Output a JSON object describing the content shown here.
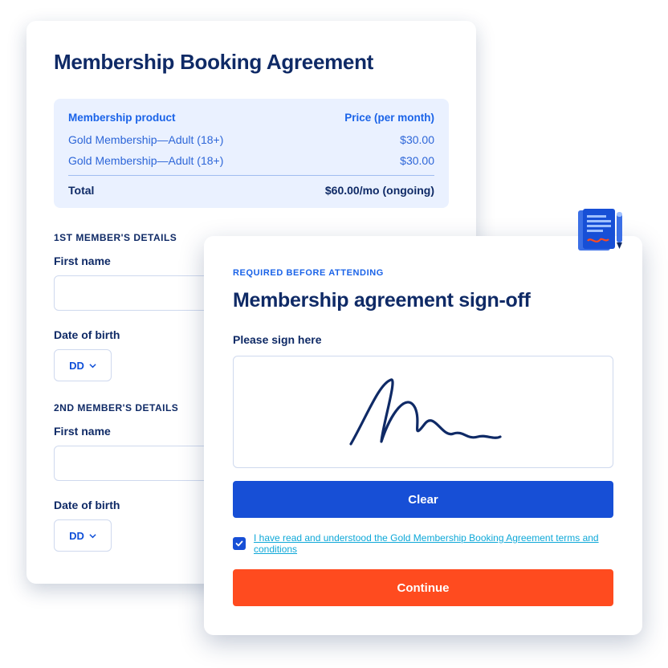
{
  "back": {
    "title": "Membership Booking Agreement",
    "table": {
      "head_product": "Membership product",
      "head_price": "Price (per month)",
      "rows": [
        {
          "product": "Gold Membership—Adult (18+)",
          "price": "$30.00"
        },
        {
          "product": "Gold Membership—Adult (18+)",
          "price": "$30.00"
        }
      ],
      "total_label": "Total",
      "total_value": "$60.00/mo (ongoing)"
    },
    "member1": {
      "section": "1ST MEMBER'S DETAILS",
      "first_name_label": "First name",
      "dob_label": "Date of birth",
      "dd": "DD"
    },
    "member2": {
      "section": "2ND MEMBER'S DETAILS",
      "first_name_label": "First name",
      "dob_label": "Date of birth",
      "dd": "DD"
    }
  },
  "front": {
    "overline": "REQUIRED BEFORE ATTENDING",
    "title": "Membership agreement sign-off",
    "sign_label": "Please sign here",
    "clear_label": "Clear",
    "consent_text": "I have read and understood the Gold Membership Booking Agreement terms and conditions",
    "continue_label": "Continue",
    "consent_checked": true
  },
  "colors": {
    "navy": "#0f2a66",
    "blue": "#174fd6",
    "link": "#0ea8d8",
    "orange": "#ff4b1f",
    "panel": "#eaf1ff"
  }
}
